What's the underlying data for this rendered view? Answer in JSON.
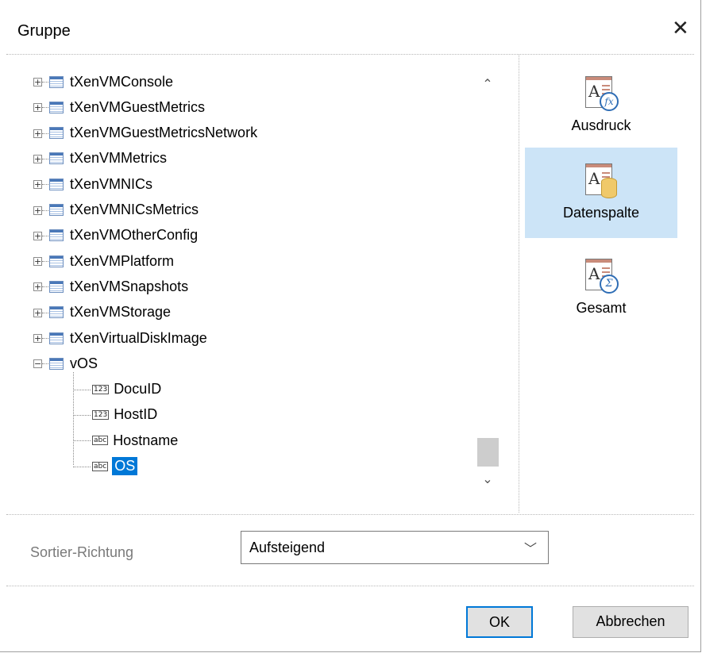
{
  "dialog": {
    "title": "Gruppe",
    "close_icon": "close-icon"
  },
  "tree": {
    "tables": [
      "tXenVMConsole",
      "tXenVMGuestMetrics",
      "tXenVMGuestMetricsNetwork",
      "tXenVMMetrics",
      "tXenVMNICs",
      "tXenVMNICsMetrics",
      "tXenVMOtherConfig",
      "tXenVMPlatform",
      "tXenVMSnapshots",
      "tXenVMStorage",
      "tXenVirtualDiskImage"
    ],
    "expanded_table": "vOS",
    "fields": [
      {
        "label": "DocuID",
        "type_icon": "123",
        "selected": false
      },
      {
        "label": "HostID",
        "type_icon": "123",
        "selected": false
      },
      {
        "label": "Hostname",
        "type_icon": "abc",
        "selected": false
      },
      {
        "label": "OS",
        "type_icon": "abc",
        "selected": true
      }
    ],
    "scroll_up_glyph": "⌃",
    "scroll_down_glyph": "⌄"
  },
  "tools": [
    {
      "label": "Ausdruck",
      "icon": "expression-icon",
      "badge": "fx",
      "active": false
    },
    {
      "label": "Datenspalte",
      "icon": "data-column-icon",
      "badge": "",
      "active": true
    },
    {
      "label": "Gesamt",
      "icon": "total-icon",
      "badge": "Σ",
      "active": false
    }
  ],
  "sort": {
    "label": "Sortier-Richtung",
    "value": "Aufsteigend"
  },
  "buttons": {
    "ok": "OK",
    "cancel": "Abbrechen"
  },
  "colors": {
    "selection": "#0078d7",
    "active_tool": "#cce4f7"
  }
}
